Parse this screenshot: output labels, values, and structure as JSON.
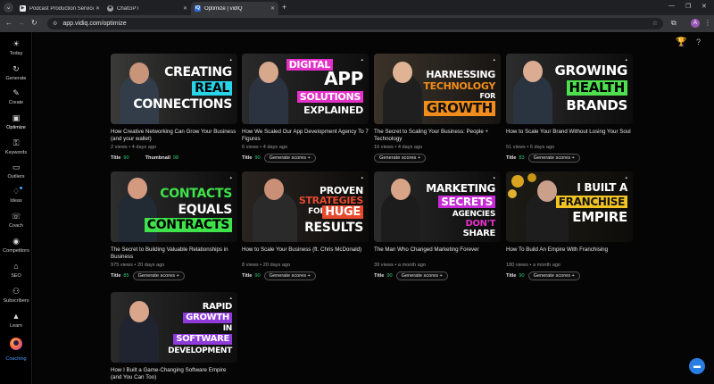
{
  "browser": {
    "tabs": [
      {
        "title": "Podcast Production Services - S",
        "favicon": "podcast-favicon",
        "favicon_color": "#e8eaed",
        "active": false
      },
      {
        "title": "ChatGPT",
        "favicon": "chatgpt-favicon",
        "favicon_color": "#9aa0a6",
        "active": false
      },
      {
        "title": "Optimize | vidIQ",
        "favicon": "vidiq-favicon",
        "favicon_color": "#2d6cdf",
        "active": true
      }
    ],
    "url": "app.vidiq.com/optimize",
    "profile_initial": "A"
  },
  "sidebar": {
    "items": [
      {
        "label": "Today",
        "icon": "sun-icon"
      },
      {
        "label": "Generate",
        "icon": "refresh-icon"
      },
      {
        "label": "Create",
        "icon": "wand-icon"
      },
      {
        "label": "Optimize",
        "icon": "briefcase-icon"
      },
      {
        "label": "Keywords",
        "icon": "key-icon"
      },
      {
        "label": "Outliers",
        "icon": "monitor-icon"
      },
      {
        "label": "Ideas",
        "icon": "bulb-icon"
      },
      {
        "label": "Coach",
        "icon": "chat-icon"
      },
      {
        "label": "Competitors",
        "icon": "eye-icon"
      },
      {
        "label": "SEO",
        "icon": "tag-icon"
      },
      {
        "label": "Subscribers",
        "icon": "users-icon"
      },
      {
        "label": "Learn",
        "icon": "cap-icon"
      },
      {
        "label": "Coaching",
        "icon": "coach-avatar"
      }
    ]
  },
  "actions": {
    "generate_label": "Generate scores",
    "title_label": "Title",
    "thumbnail_label": "Thumbnail"
  },
  "videos": [
    {
      "title": "How Creative Networking Can Grow Your Business (and your wallet)",
      "meta": "2 views • 4 days ago",
      "title_score": "90",
      "thumbnail_score": "98",
      "thumb_lines": [
        "CREATING",
        "REAL",
        "CONNECTIONS"
      ]
    },
    {
      "title": "How We Scaled Our App Development Agency To 7 Figures",
      "meta": "6 views • 4 days ago",
      "title_score": "90",
      "thumb_lines": [
        "DIGITAL",
        "APP",
        "SOLUTIONS",
        "EXPLAINED"
      ]
    },
    {
      "title": "The Secret to Scaling Your Business: People + Technology",
      "meta": "16 views • 4 days ago",
      "thumb_lines": [
        "HARNESSING",
        "TECHNOLOGY",
        "FOR",
        "GROWTH"
      ]
    },
    {
      "title": "How to Scale Your Brand Without Losing Your Soul",
      "meta": "51 views • 6 days ago",
      "title_score": "83",
      "thumb_lines": [
        "GROWING",
        "HEALTH",
        "BRANDS"
      ]
    },
    {
      "title": "The Secret to Building Valuable Relationships in Business",
      "meta": "975 views • 20 days ago",
      "title_score": "85",
      "thumb_lines": [
        "CONTACTS",
        "EQUALS",
        "CONTRACTS"
      ]
    },
    {
      "title": "How to Scale Your Business (ft. Chris McDonald)",
      "meta": "8 views • 20 days ago",
      "title_score": "90",
      "thumb_lines": [
        "PROVEN",
        "STRATEGIES",
        "FOR",
        "HUGE",
        "RESULTS"
      ]
    },
    {
      "title": "The Man Who Changed Marketing Forever",
      "meta": "39 views • a month ago",
      "title_score": "90",
      "thumb_lines": [
        "MARKETING",
        "SECRETS",
        "AGENCIES",
        "DON'T",
        "SHARE"
      ]
    },
    {
      "title": "How To Build An Empire With Franchising",
      "meta": "180 views • a month ago",
      "title_score": "90",
      "thumb_lines": [
        "I BUILT A",
        "FRANCHISE",
        "EMPIRE"
      ]
    },
    {
      "title": "How I Built a Game-Changing Software Empire (and You Can Too)",
      "meta": "",
      "thumb_lines": [
        "RAPID",
        "GROWTH",
        "IN",
        "SOFTWARE",
        "DEVELOPMENT"
      ]
    }
  ],
  "colors": {
    "accent": "#4d9dff",
    "score_green": "#2ecc71",
    "chat_button": "#2a7de1"
  }
}
